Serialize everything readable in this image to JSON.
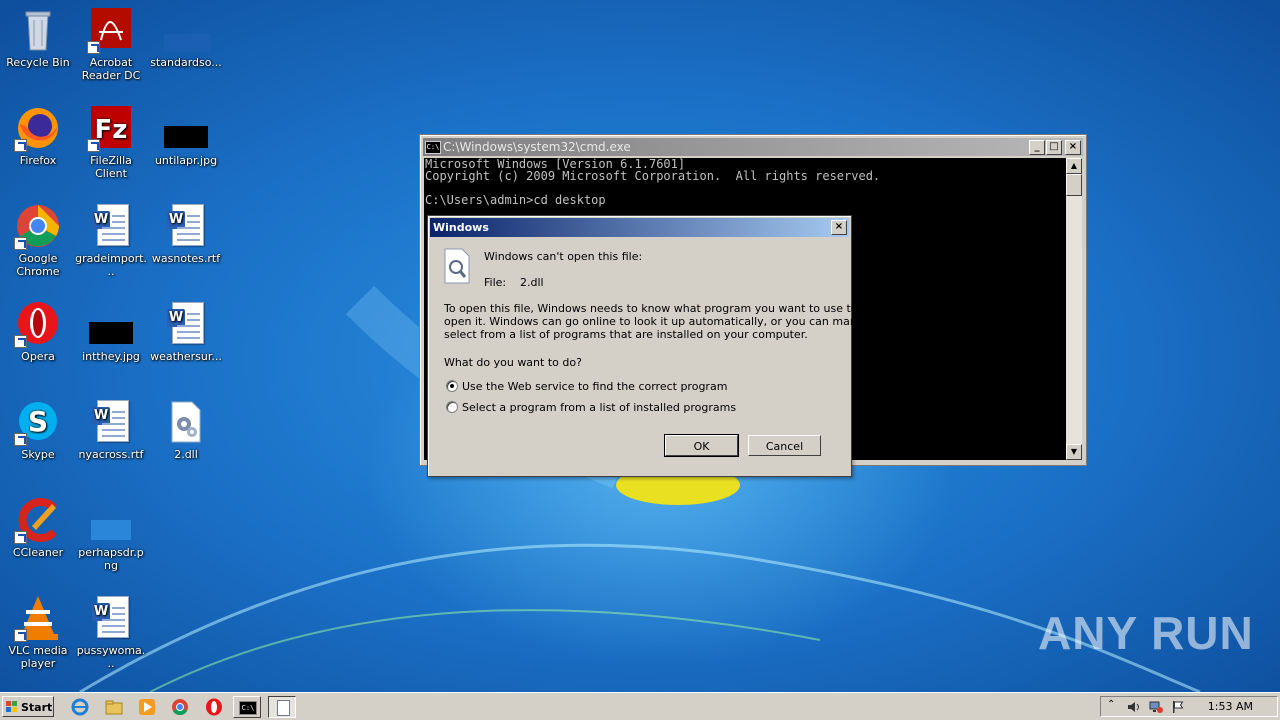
{
  "desktop": {
    "icons": [
      {
        "label": "Recycle Bin"
      },
      {
        "label": "Acrobat Reader DC"
      },
      {
        "label": "standardso..."
      },
      {
        "label": "Firefox"
      },
      {
        "label": "FileZilla Client"
      },
      {
        "label": "untilapr.jpg"
      },
      {
        "label": "Google Chrome"
      },
      {
        "label": "gradeimport..."
      },
      {
        "label": "wasnotes.rtf"
      },
      {
        "label": "Opera"
      },
      {
        "label": "intthey.jpg"
      },
      {
        "label": "weathersur..."
      },
      {
        "label": "Skype"
      },
      {
        "label": "nyacross.rtf"
      },
      {
        "label": "2.dll"
      },
      {
        "label": "CCleaner"
      },
      {
        "label": "perhapsdr.png"
      },
      {
        "label": "VLC media player"
      },
      {
        "label": "pussywoma..."
      }
    ]
  },
  "cmd": {
    "title": "C:\\Windows\\system32\\cmd.exe",
    "icon_text": "C:\\",
    "lines": [
      "Microsoft Windows [Version 6.1.7601]",
      "Copyright (c) 2009 Microsoft Corporation.  All rights reserved.",
      "",
      "C:\\Users\\admin>cd desktop"
    ]
  },
  "dialog": {
    "title": "Windows",
    "message": "Windows can't open this file:",
    "file_label": "File:",
    "file_name": "2.dll",
    "description_lines": [
      "To open this file, Windows needs to know what program you want to use to",
      "open it. Windows can go online to look it up automatically, or you can manually",
      "select from a list of programs that are installed on your computer."
    ],
    "question": "What do you want to do?",
    "option_web": "Use the Web service to find the correct program",
    "option_list": "Select a program from a list of installed programs",
    "selected_option": "web",
    "ok_label": "OK",
    "cancel_label": "Cancel"
  },
  "taskbar": {
    "start_label": "Start",
    "clock": "1:53 AM"
  },
  "watermark": "ANY RUN"
}
